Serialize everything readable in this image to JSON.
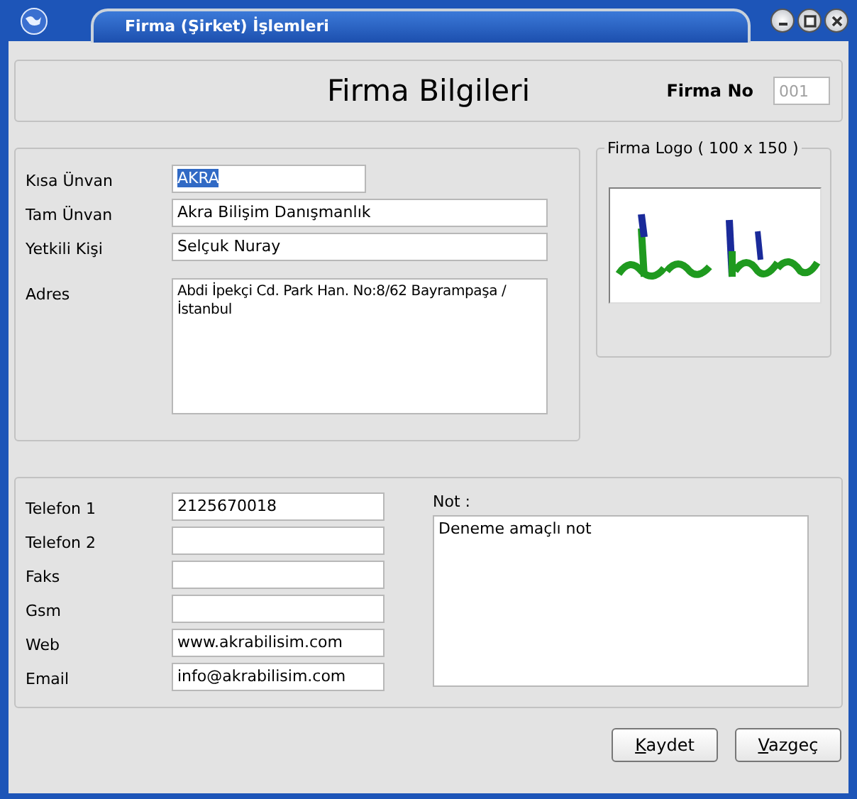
{
  "window": {
    "title": "Firma (Şirket) İşlemleri"
  },
  "header": {
    "title": "Firma Bilgileri",
    "firm_no": {
      "label": "Firma No",
      "value": "001",
      "disabled": true
    }
  },
  "main_fields": [
    {
      "label": "Kısa Ünvan",
      "value": "AKRA",
      "kind": "short",
      "text_selected": true
    },
    {
      "label": "Tam Ünvan",
      "value": "Akra Bilişim Danışmanlık",
      "kind": "line",
      "text_selected": false
    },
    {
      "label": "Yetkili Kişi",
      "value": "Selçuk Nuray",
      "kind": "line",
      "text_selected": false
    },
    {
      "label": "Adres",
      "value": "Abdi İpekçi Cd. Park Han. No:8/62 Bayrampaşa / İstanbul",
      "kind": "multiline",
      "text_selected": false
    }
  ],
  "logo": {
    "label": "Firma Logo ( 100 x 150 )",
    "kind": "picture"
  },
  "contact_fields": [
    {
      "label": "Telefon 1",
      "value": "2125670018"
    },
    {
      "label": "Telefon 2"
    },
    {
      "label": "Faks"
    },
    {
      "label": "Gsm"
    },
    {
      "label": "Web",
      "value": "www.akrabilisim.com"
    },
    {
      "label": "Email",
      "value": "info@akrabilisim.com"
    }
  ],
  "note": {
    "label": "Not :",
    "value": "Deneme amaçlı not"
  },
  "buttons": [
    {
      "label": "Kaydet",
      "underline_first": true
    },
    {
      "label": "Vazgeç",
      "underline_first": true
    }
  ]
}
